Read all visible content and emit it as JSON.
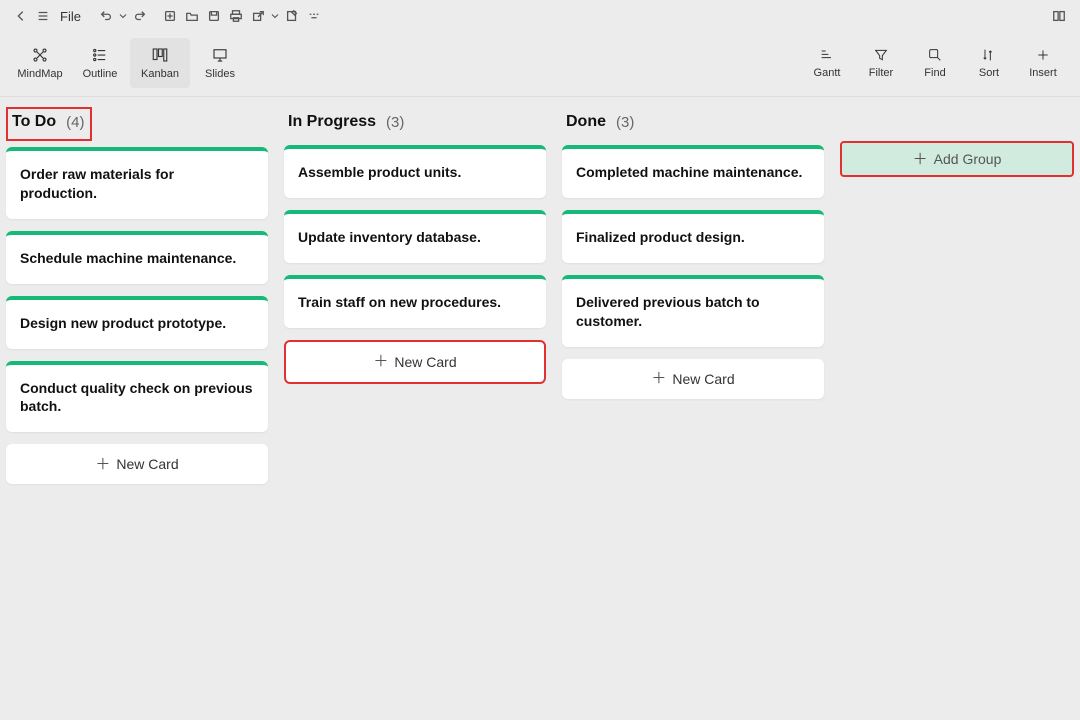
{
  "titlebar": {
    "file_label": "File"
  },
  "views": {
    "mindmap": "MindMap",
    "outline": "Outline",
    "kanban": "Kanban",
    "slides": "Slides"
  },
  "tools": {
    "gantt": "Gantt",
    "filter": "Filter",
    "find": "Find",
    "sort": "Sort",
    "insert": "Insert"
  },
  "columns": [
    {
      "title": "To Do",
      "count": "(4)",
      "highlight_header": true,
      "highlight_newcard": false,
      "cards": [
        "Order raw materials for production.",
        "Schedule machine maintenance.",
        "Design new product prototype.",
        "Conduct quality check on previous batch."
      ]
    },
    {
      "title": "In Progress",
      "count": "(3)",
      "highlight_header": false,
      "highlight_newcard": true,
      "cards": [
        "Assemble product units.",
        "Update inventory database.",
        "Train staff on new procedures."
      ]
    },
    {
      "title": "Done",
      "count": "(3)",
      "highlight_header": false,
      "highlight_newcard": false,
      "cards": [
        "Completed machine maintenance.",
        "Finalized product design.",
        "Delivered previous batch to customer."
      ]
    }
  ],
  "new_card_label": "New Card",
  "add_group_label": "Add Group"
}
